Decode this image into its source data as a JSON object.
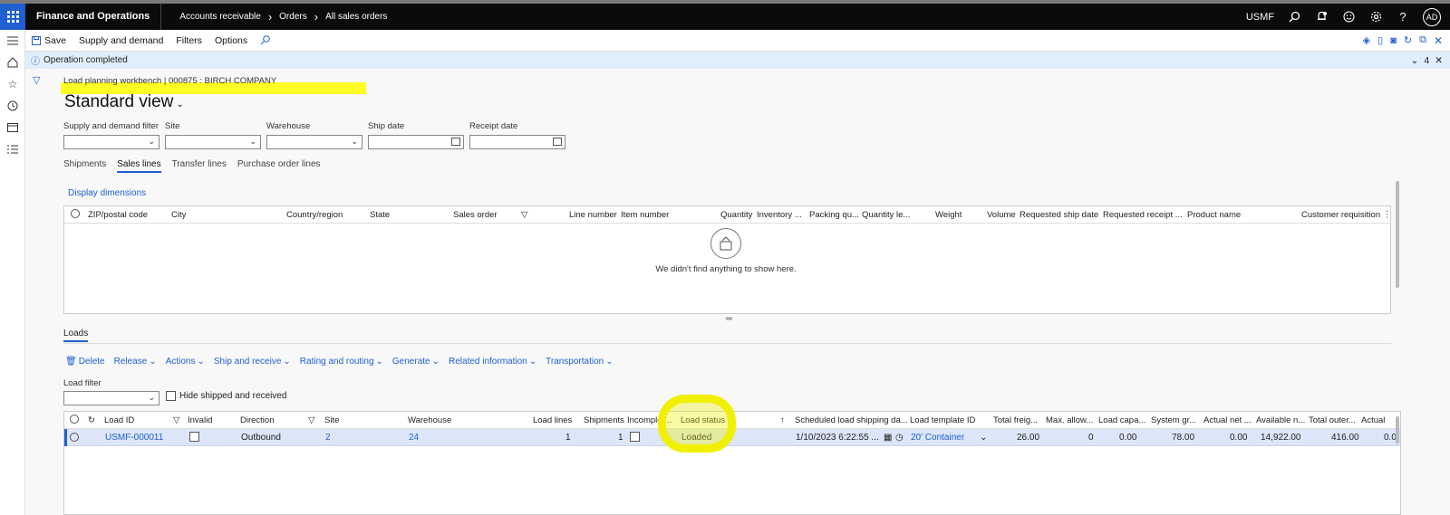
{
  "header": {
    "app_name": "Finance and Operations",
    "breadcrumbs": [
      "Accounts receivable",
      "Orders",
      "All sales orders"
    ],
    "company": "USMF",
    "avatar_initials": "AD"
  },
  "action_pane": {
    "save": "Save",
    "supply_demand": "Supply and demand",
    "filters": "Filters",
    "options": "Options"
  },
  "message_bar": {
    "text": "Operation completed",
    "count": "4"
  },
  "caption": "Load planning workbench  |  000875 : BIRCH COMPANY",
  "view_title": "Standard view",
  "filters": [
    {
      "label": "Supply and demand filter",
      "type": "select",
      "value": ""
    },
    {
      "label": "Site",
      "type": "select",
      "value": ""
    },
    {
      "label": "Warehouse",
      "type": "select",
      "value": ""
    },
    {
      "label": "Ship date",
      "type": "date",
      "value": ""
    },
    {
      "label": "Receipt date",
      "type": "date",
      "value": ""
    }
  ],
  "tabs": [
    "Shipments",
    "Sales lines",
    "Transfer lines",
    "Purchase order lines"
  ],
  "active_tab": "Sales lines",
  "display_dimensions": "Display dimensions",
  "grid1": {
    "columns": [
      "ZIP/postal code",
      "City",
      "Country/region",
      "State",
      "Sales order",
      "Line number",
      "Item number",
      "Quantity",
      "Inventory ...",
      "Packing qu...",
      "Quantity le...",
      "Weight",
      "Volume",
      "Requested ship date",
      "Requested receipt ...",
      "Product name",
      "Customer requisition"
    ],
    "empty_text": "We didn't find anything to show here."
  },
  "loads": {
    "tab_label": "Loads",
    "toolbar": [
      "Delete",
      "Release",
      "Actions",
      "Ship and receive",
      "Rating and routing",
      "Generate",
      "Related information",
      "Transportation"
    ],
    "load_filter_label": "Load filter",
    "load_filter_value": "",
    "hide_shipped_label": "Hide shipped and received",
    "columns": [
      "Load ID",
      "Invalid",
      "Direction",
      "Site",
      "Warehouse",
      "Load lines",
      "Shipments",
      "Incomplet...",
      "Load status",
      "Scheduled load shipping da...",
      "Load template ID",
      "Total freig...",
      "Max. allow...",
      "Load capa...",
      "System gr...",
      "Actual net ...",
      "Available n...",
      "Total outer...",
      "Actual"
    ],
    "rows": [
      {
        "load_id": "USMF-000011",
        "invalid": false,
        "direction": "Outbound",
        "site": "2",
        "warehouse": "24",
        "load_lines": "1",
        "shipments": "1",
        "incomplete": false,
        "load_status": "Loaded",
        "scheduled_ship": "1/10/2023 6:22:55 ...",
        "template": "20' Container",
        "total_freight": "26.00",
        "max_allow": "0",
        "load_capacity": "0.00",
        "system_gross": "78.00",
        "actual_net": "0.00",
        "available_net": "14,922.00",
        "total_outer": "416.00",
        "actual": "0.0"
      }
    ]
  },
  "colors": {
    "accent": "#1f5fd0",
    "highlight": "#f0f000",
    "topbar": "#0b0b0b",
    "selected_row": "#dce6f8"
  }
}
